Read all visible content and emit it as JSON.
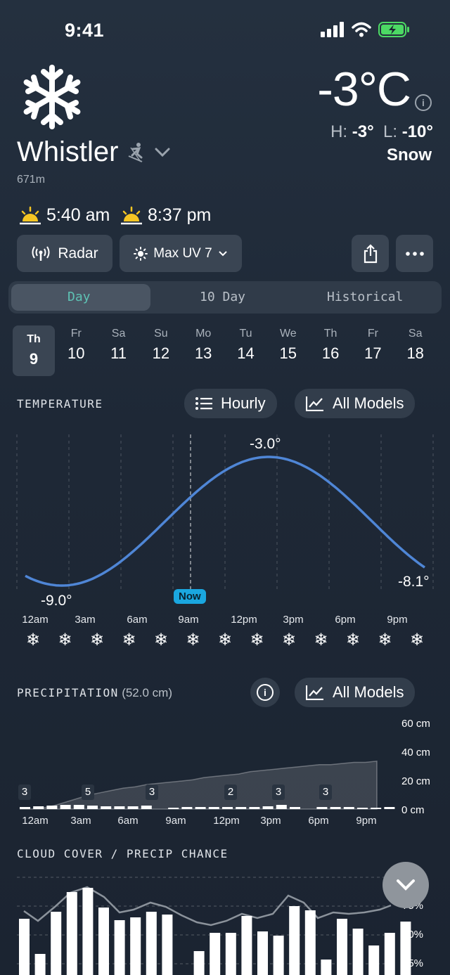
{
  "status": {
    "time": "9:41"
  },
  "location": {
    "city": "Whistler",
    "elevation": "671m"
  },
  "current": {
    "temp": "-3°C",
    "hi_label": "H:",
    "hi": "-3°",
    "lo_label": "L:",
    "lo": "-10°",
    "condition": "Snow"
  },
  "sun": {
    "sunrise": "5:40 am",
    "sunset": "8:37 pm"
  },
  "actions": {
    "radar": "Radar",
    "uv": "Max UV 7"
  },
  "tabs": [
    "Day",
    "10 Day",
    "Historical"
  ],
  "days": [
    {
      "dw": "Th",
      "dn": "9"
    },
    {
      "dw": "Fr",
      "dn": "10"
    },
    {
      "dw": "Sa",
      "dn": "11"
    },
    {
      "dw": "Su",
      "dn": "12"
    },
    {
      "dw": "Mo",
      "dn": "13"
    },
    {
      "dw": "Tu",
      "dn": "14"
    },
    {
      "dw": "We",
      "dn": "15"
    },
    {
      "dw": "Th",
      "dn": "16"
    },
    {
      "dw": "Fr",
      "dn": "17"
    },
    {
      "dw": "Sa",
      "dn": "18"
    }
  ],
  "temperature": {
    "title": "TEMPERATURE",
    "hourly": "Hourly",
    "models": "All Models",
    "max_label": "-3.0°",
    "min_label": "-9.0°",
    "end_label": "-8.1°",
    "now": "Now",
    "ticks": [
      "12am",
      "3am",
      "6am",
      "9am",
      "12pm",
      "3pm",
      "6pm",
      "9pm"
    ],
    "icons": [
      "❄",
      "❄",
      "❄",
      "❄",
      "❄",
      "❄",
      "❄",
      "❄",
      "❄",
      "❄",
      "❄",
      "❄",
      "❄"
    ]
  },
  "precipitation": {
    "title": "PRECIPITATION",
    "total": "(52.0 cm)",
    "models": "All Models",
    "yticks": [
      "60 cm",
      "40 cm",
      "20 cm",
      "0 cm"
    ],
    "ticks": [
      "12am",
      "3am",
      "6am",
      "9am",
      "12pm",
      "3pm",
      "6pm",
      "9pm"
    ],
    "bar_labels": [
      "3",
      "5",
      "3",
      "2",
      "3",
      "3"
    ]
  },
  "cloud": {
    "title": "CLOUD COVER / PRECIP CHANCE",
    "yticks": [
      "%",
      "75%",
      "50%",
      "25%"
    ]
  },
  "chart_data": [
    {
      "type": "line",
      "title": "TEMPERATURE",
      "x": [
        "12am",
        "3am",
        "6am",
        "9am",
        "12pm",
        "3pm",
        "6pm",
        "9pm"
      ],
      "min": -9.0,
      "max": -3.0,
      "end": -8.1
    },
    {
      "type": "bar",
      "title": "PRECIPITATION",
      "ylim": [
        0,
        60
      ],
      "bar_labels": [
        3,
        5,
        3,
        2,
        3,
        3
      ]
    }
  ]
}
